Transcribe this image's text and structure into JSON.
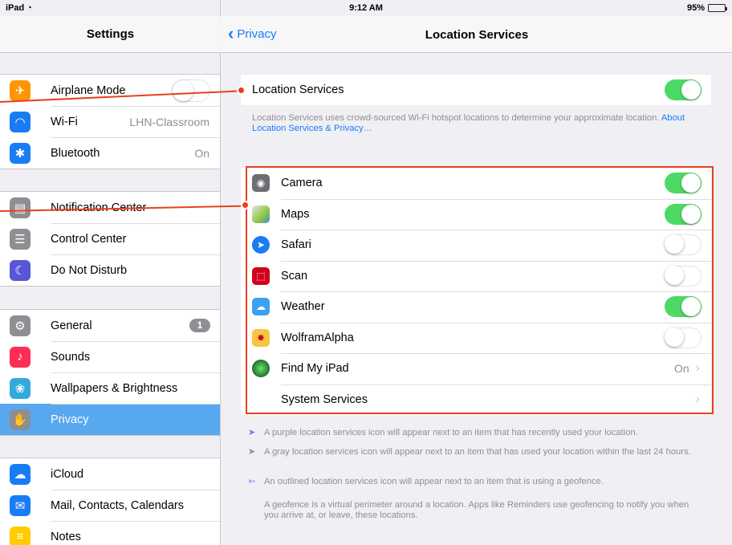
{
  "status_bar": {
    "carrier": "iPad",
    "wifi_icon": "wifi-icon",
    "time": "9:12 AM",
    "battery": "95%",
    "battery_level": 0.95
  },
  "sidebar": {
    "title": "Settings",
    "groups": [
      [
        {
          "label": "Airplane Mode",
          "icon": "airplane-icon",
          "color": "#ff9500",
          "control": "toggle-off"
        },
        {
          "label": "Wi-Fi",
          "icon": "wifi-icon",
          "color": "#1a7cf5",
          "value": "LHN-Classroom"
        },
        {
          "label": "Bluetooth",
          "icon": "bluetooth-icon",
          "color": "#1a7cf5",
          "value": "On"
        }
      ],
      [
        {
          "label": "Notification Center",
          "icon": "notification-center-icon",
          "color": "#8e8e93"
        },
        {
          "label": "Control Center",
          "icon": "control-center-icon",
          "color": "#8e8e93"
        },
        {
          "label": "Do Not Disturb",
          "icon": "moon-icon",
          "color": "#5856d6"
        }
      ],
      [
        {
          "label": "General",
          "icon": "gear-icon",
          "color": "#8e8e93",
          "badge": "1"
        },
        {
          "label": "Sounds",
          "icon": "speaker-icon",
          "color": "#ff2d55"
        },
        {
          "label": "Wallpapers & Brightness",
          "icon": "wallpaper-icon",
          "color": "#34aadc"
        },
        {
          "label": "Privacy",
          "icon": "hand-icon",
          "color": "#8e8e93",
          "selected": true
        }
      ],
      [
        {
          "label": "iCloud",
          "icon": "cloud-icon",
          "color": "#1a7cf5"
        },
        {
          "label": "Mail, Contacts, Calendars",
          "icon": "mail-icon",
          "color": "#1a7cf5"
        },
        {
          "label": "Notes",
          "icon": "notes-icon",
          "color": "#ffcc00"
        }
      ]
    ]
  },
  "main": {
    "back_label": "Privacy",
    "title": "Location Services",
    "location_services": {
      "label": "Location Services",
      "enabled": true
    },
    "description": "Location Services uses crowd-sourced Wi-Fi hotspot locations to determine your approximate location.",
    "description_link": "About Location Services & Privacy…",
    "apps": [
      {
        "label": "Camera",
        "icon": "camera-icon",
        "color": "#6d6d72",
        "control": "on"
      },
      {
        "label": "Maps",
        "icon": "maps-icon",
        "color": "#8dc63f",
        "control": "on"
      },
      {
        "label": "Safari",
        "icon": "safari-icon",
        "color": "#1a7cf5",
        "control": "off"
      },
      {
        "label": "Scan",
        "icon": "scan-icon",
        "color": "#d0021b",
        "control": "off"
      },
      {
        "label": "Weather",
        "icon": "weather-icon",
        "color": "#3ba1f0",
        "control": "on"
      },
      {
        "label": "WolframAlpha",
        "icon": "wolframalpha-icon",
        "color": "#f6c544",
        "control": "off"
      },
      {
        "label": "Find My iPad",
        "icon": "find-my-ipad-icon",
        "color": "#2e8b3b",
        "value": "On"
      },
      {
        "label": "System Services"
      }
    ],
    "legend": [
      {
        "icon": "purple-arrow-icon",
        "color": "#a55ee8",
        "text": "A purple location services icon will appear next to an item that has recently used your location."
      },
      {
        "icon": "gray-arrow-icon",
        "color": "#8e8e93",
        "text": "A gray location services icon will appear next to an item that has used your location within the last 24 hours."
      },
      {
        "icon": "outlined-arrow-icon",
        "color": "#a55ee8",
        "text": "An outlined location services icon will appear next to an item that is using a geofence."
      }
    ],
    "geofence_note": "A geofence is a virtual perimeter around a location. Apps like Reminders use geofencing to notify you when you arrive at, or leave, these locations."
  },
  "colors": {
    "accent": "#1a7cf5",
    "toggle_on": "#4cd964",
    "annotation": "#e8401c",
    "selected_row": "#58a8f0"
  }
}
